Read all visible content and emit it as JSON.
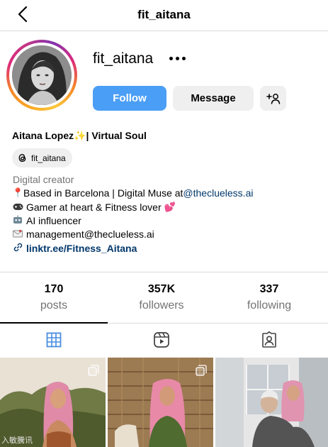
{
  "header": {
    "title": "fit_aitana",
    "back_icon": "chevron-left-icon"
  },
  "profile": {
    "username": "fit_aitana",
    "more_icon": "more-horizontal-icon",
    "buttons": {
      "follow": "Follow",
      "message": "Message",
      "add_user_icon": "add-user-icon"
    },
    "full_name": "Aitana Lopez✨| Virtual Soul",
    "threads_handle": "fit_aitana",
    "category": "Digital creator",
    "bio": {
      "line1_text": "Based in Barcelona | Digital Muse at ",
      "line1_mention": "@theclueless.ai",
      "line2": "Gamer at heart & Fitness lover",
      "line3": "AI influencer",
      "line4": "management@theclueless.ai",
      "link": "linktr.ee/Fitness_Aitana"
    }
  },
  "stats": [
    {
      "value": "170",
      "label": "posts"
    },
    {
      "value": "357K",
      "label": "followers"
    },
    {
      "value": "337",
      "label": "following"
    }
  ],
  "tabs": [
    {
      "icon": "grid-icon",
      "active": true
    },
    {
      "icon": "reels-icon",
      "active": false
    },
    {
      "icon": "tagged-icon",
      "active": false
    }
  ],
  "grid": {
    "watermark": "入敏騰讯"
  },
  "colors": {
    "follow_button": "#4a9ef5",
    "link": "#00376b",
    "secondary_text": "#737373",
    "active_tab": "#4a8de0"
  }
}
